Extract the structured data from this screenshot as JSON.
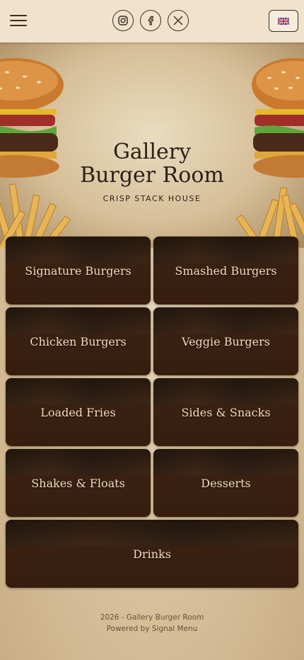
{
  "header": {
    "menu_icon": "hamburger-menu-icon",
    "socials": [
      {
        "name": "instagram",
        "icon": "instagram-icon"
      },
      {
        "name": "facebook",
        "icon": "facebook-icon"
      },
      {
        "name": "x",
        "icon": "x-icon"
      }
    ],
    "language_flag": "uk-flag-icon"
  },
  "hero": {
    "title_line1": "Gallery",
    "title_line2": "Burger Room",
    "subtitle": "CRISP STACK HOUSE"
  },
  "categories": [
    {
      "label": "Signature Burgers"
    },
    {
      "label": "Smashed Burgers"
    },
    {
      "label": "Chicken Burgers"
    },
    {
      "label": "Veggie Burgers"
    },
    {
      "label": "Loaded Fries"
    },
    {
      "label": "Sides & Snacks"
    },
    {
      "label": "Shakes & Floats"
    },
    {
      "label": "Desserts"
    },
    {
      "label": "Drinks"
    }
  ],
  "footer": {
    "line1": "2026 - Gallery Burger Room",
    "line2": "Powered by Signal Menu"
  },
  "colors": {
    "header_bg": "#f1e3cb",
    "text_dark": "#2b1f17",
    "tile_label": "#f0dcc0"
  }
}
